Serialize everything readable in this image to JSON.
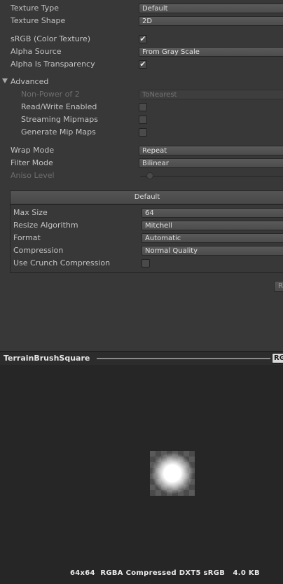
{
  "importer": {
    "texture_type": {
      "label": "Texture Type",
      "value": "Default"
    },
    "texture_shape": {
      "label": "Texture Shape",
      "value": "2D"
    },
    "srgb": {
      "label": "sRGB (Color Texture)",
      "checked": true
    },
    "alpha_source": {
      "label": "Alpha Source",
      "value": "From Gray Scale"
    },
    "alpha_is_transparency": {
      "label": "Alpha Is Transparency",
      "checked": true
    },
    "advanced": {
      "label": "Advanced",
      "non_power_of_2": {
        "label": "Non-Power of 2",
        "value": "ToNearest"
      },
      "read_write": {
        "label": "Read/Write Enabled",
        "checked": false
      },
      "streaming_mipmaps": {
        "label": "Streaming Mipmaps",
        "checked": false
      },
      "generate_mip_maps": {
        "label": "Generate Mip Maps",
        "checked": false
      }
    },
    "wrap_mode": {
      "label": "Wrap Mode",
      "value": "Repeat"
    },
    "filter_mode": {
      "label": "Filter Mode",
      "value": "Bilinear"
    },
    "aniso_level": {
      "label": "Aniso Level"
    },
    "check_glyph": "✔"
  },
  "platform": {
    "tab_label": "Default",
    "max_size": {
      "label": "Max Size",
      "value": "64"
    },
    "resize_algorithm": {
      "label": "Resize Algorithm",
      "value": "Mitchell"
    },
    "format": {
      "label": "Format",
      "value": "Automatic"
    },
    "compression": {
      "label": "Compression",
      "value": "Normal Quality"
    },
    "crunch": {
      "label": "Use Crunch Compression",
      "checked": false
    }
  },
  "revert_button": "R",
  "preview": {
    "title": "TerrainBrushSquare",
    "channel_button": "RG",
    "info": "64x64  RGBA Compressed DXT5 sRGB   4.0 KB"
  },
  "colors": {
    "panel_bg": "#383838",
    "preview_bg": "#262626",
    "text": "#c4c4c4",
    "disabled_text": "#6e6e6e"
  }
}
